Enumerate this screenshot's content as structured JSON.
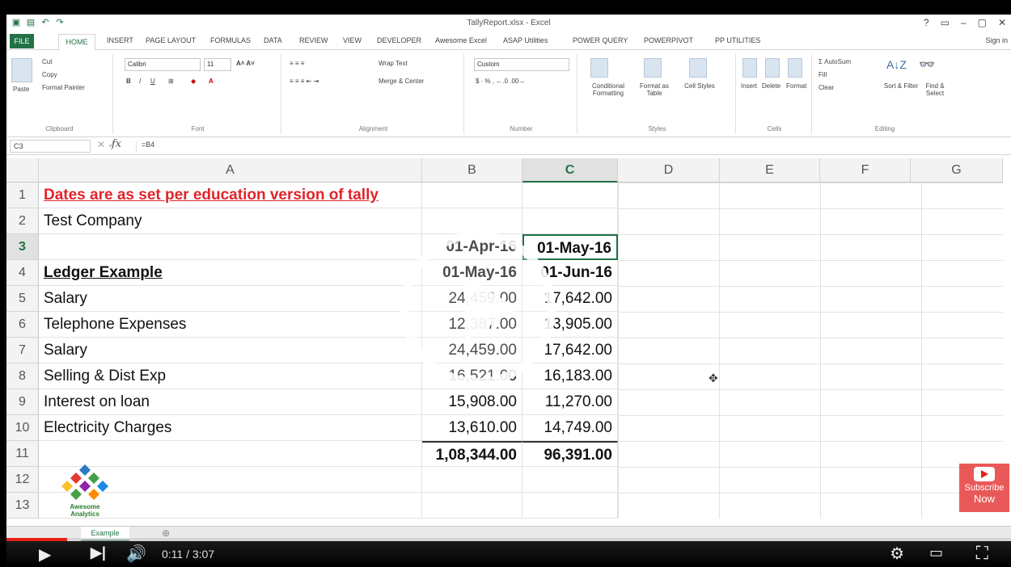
{
  "window": {
    "title": "TallyReport.xlsx - Excel",
    "controls": [
      "?",
      "▭",
      "–",
      "▢",
      "✕"
    ]
  },
  "ribbon_tabs": [
    "FILE",
    "HOME",
    "INSERT",
    "PAGE LAYOUT",
    "FORMULAS",
    "DATA",
    "REVIEW",
    "VIEW",
    "DEVELOPER",
    "Awesome Excel",
    "ASAP Utilities",
    "POWER QUERY",
    "POWERPIVOT",
    "PP UTILITIES"
  ],
  "signin": "Sign in",
  "ribbon": {
    "clipboard": {
      "paste": "Paste",
      "cut": "Cut",
      "copy": "Copy",
      "format_painter": "Format Painter",
      "label": "Clipboard"
    },
    "font": {
      "name": "Calibri",
      "size": "11",
      "label": "Font"
    },
    "alignment": {
      "wrap": "Wrap Text",
      "merge": "Merge & Center",
      "label": "Alignment"
    },
    "number": {
      "format": "Custom",
      "label": "Number"
    },
    "styles": {
      "conditional": "Conditional Formatting",
      "format_table": "Format as Table",
      "cell_styles": "Cell Styles",
      "label": "Styles"
    },
    "cells": {
      "insert": "Insert",
      "delete": "Delete",
      "format": "Format",
      "label": "Cells"
    },
    "editing": {
      "autosum": "AutoSum",
      "fill": "Fill",
      "clear": "Clear",
      "sort": "Sort & Filter",
      "find": "Find & Select",
      "label": "Editing"
    }
  },
  "formula_bar": {
    "name_box": "C3",
    "fx": "fx",
    "value": "=B4"
  },
  "columns": [
    "A",
    "B",
    "C",
    "D",
    "E",
    "F",
    "G"
  ],
  "rows": [
    {
      "n": "1",
      "a": "Dates are as set per education version of tally",
      "b": "",
      "c": ""
    },
    {
      "n": "2",
      "a": "Test Company",
      "b": "",
      "c": ""
    },
    {
      "n": "3",
      "a": "",
      "b": "01-Apr-16",
      "c": "01-May-16"
    },
    {
      "n": "4",
      "a": "Ledger Example",
      "b": "01-May-16",
      "c": "01-Jun-16"
    },
    {
      "n": "5",
      "a": "Salary",
      "b": "24,459.00",
      "c": "17,642.00"
    },
    {
      "n": "6",
      "a": "Telephone Expenses",
      "b": "12,387.00",
      "c": "13,905.00"
    },
    {
      "n": "7",
      "a": "Salary",
      "b": "24,459.00",
      "c": "17,642.00"
    },
    {
      "n": "8",
      "a": "Selling & Dist Exp",
      "b": "16,521.00",
      "c": "16,183.00"
    },
    {
      "n": "9",
      "a": "Interest on loan",
      "b": "15,908.00",
      "c": "11,270.00"
    },
    {
      "n": "10",
      "a": "Electricity Charges",
      "b": "13,610.00",
      "c": "14,749.00"
    },
    {
      "n": "11",
      "a": "",
      "b": "1,08,344.00",
      "c": "96,391.00"
    },
    {
      "n": "12",
      "a": "",
      "b": "",
      "c": ""
    },
    {
      "n": "13",
      "a": "",
      "b": "",
      "c": ""
    }
  ],
  "sheet_tab": "Example",
  "logo_text": "Awesome Analytics",
  "player": {
    "time": "0:11 / 3:07",
    "progress_fraction": 0.06,
    "subscribe": [
      "Subscribe",
      "Now"
    ]
  }
}
